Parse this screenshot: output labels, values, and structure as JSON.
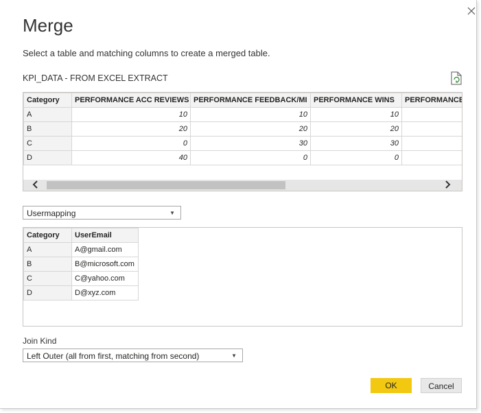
{
  "dialog": {
    "title": "Merge",
    "description": "Select a table and matching columns to create a merged table."
  },
  "first_table": {
    "name": "KPI_DATA - FROM EXCEL EXTRACT",
    "columns": [
      "Category",
      "PERFORMANCE ACC REVIEWS",
      "PERFORMANCE FEEDBACK/MI",
      "PERFORMANCE WINS",
      "PERFORMANCE C"
    ],
    "rows": [
      [
        "A",
        "10",
        "10",
        "10",
        ""
      ],
      [
        "B",
        "20",
        "20",
        "20",
        ""
      ],
      [
        "C",
        "0",
        "30",
        "30",
        ""
      ],
      [
        "D",
        "40",
        "0",
        "0",
        ""
      ]
    ],
    "scroll_left_icon": "chevron-left",
    "scroll_right_icon": "chevron-right"
  },
  "second_table": {
    "selected": "Usermapping",
    "columns": [
      "Category",
      "UserEmail"
    ],
    "rows": [
      [
        "A",
        "A@gmail.com"
      ],
      [
        "B",
        "B@microsoft.com"
      ],
      [
        "C",
        "C@yahoo.com"
      ],
      [
        "D",
        "D@xyz.com"
      ]
    ]
  },
  "join": {
    "label": "Join Kind",
    "selected": "Left Outer (all from first, matching from second)"
  },
  "buttons": {
    "ok": "OK",
    "cancel": "Cancel"
  },
  "colors": {
    "ok_button": "#f2c811",
    "header_bg": "#f3f3f3"
  }
}
